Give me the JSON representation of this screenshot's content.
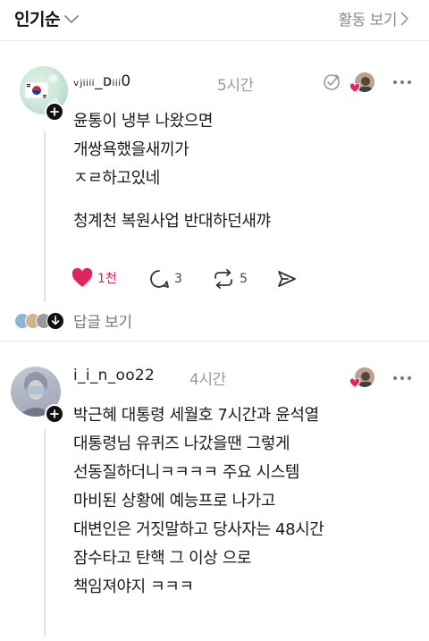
{
  "topbar": {
    "sort_label": "인기순",
    "activity_label": "활동 보기"
  },
  "comments": [
    {
      "username": "ᵥⱼᵢᵢᵢᵢ_ᴅᵢᵢᵢ0",
      "time": "5시간",
      "lines": [
        "윤통이 냉부 나왔으면",
        "개쌍욕했을새끼가",
        "ㅈㄹ하고있네",
        "",
        "청계천 복원사업 반대하던새꺄"
      ],
      "actions": {
        "like_count": "1천",
        "reply_count": "3",
        "repost_count": "5"
      },
      "view_replies_label": "답글 보기"
    },
    {
      "username": "i_i_n_oo22",
      "time": "4시간",
      "lines": [
        "박근혜 대통령 세월호 7시간과 윤석열",
        "대통령님 유퀴즈 나갔을땐 그렇게",
        "선동질하더니ㅋㅋㅋㅋ 주요 시스템",
        "마비된 상황에 예능프로 나가고",
        "대변인은 거짓말하고 당사자는 48시간",
        "잠수타고  탄핵 그 이상 으로",
        "책임져야지 ㅋㅋㅋ"
      ]
    }
  ],
  "colors": {
    "like_red": "#e0245e",
    "muted_gray": "#9a9a9a",
    "divider": "#e6e6e6"
  },
  "icons": [
    "chevron-down-icon",
    "chevron-right-icon",
    "plus-icon",
    "heart-icon",
    "comment-bubble-icon",
    "repost-icon",
    "send-icon",
    "more-dots-icon",
    "arrow-down-icon",
    "no-repost-icon"
  ]
}
